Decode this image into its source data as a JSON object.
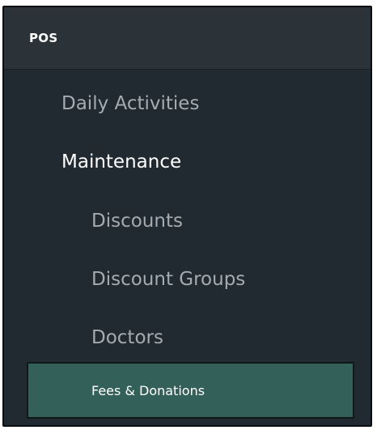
{
  "header": {
    "title": "POS"
  },
  "menu": {
    "items": [
      {
        "label": "Daily Activities"
      },
      {
        "label": "Maintenance"
      },
      {
        "label": "Discounts"
      },
      {
        "label": "Discount Groups"
      },
      {
        "label": "Doctors"
      },
      {
        "label": "Fees & Donations"
      }
    ],
    "selected": "Fees & Donations"
  },
  "colors": {
    "panel_bg": "#222a31",
    "header_bg": "#2b3339",
    "selected_bg": "#34605a",
    "text_dim": "#a4acb2",
    "text_bright": "#ffffff"
  }
}
